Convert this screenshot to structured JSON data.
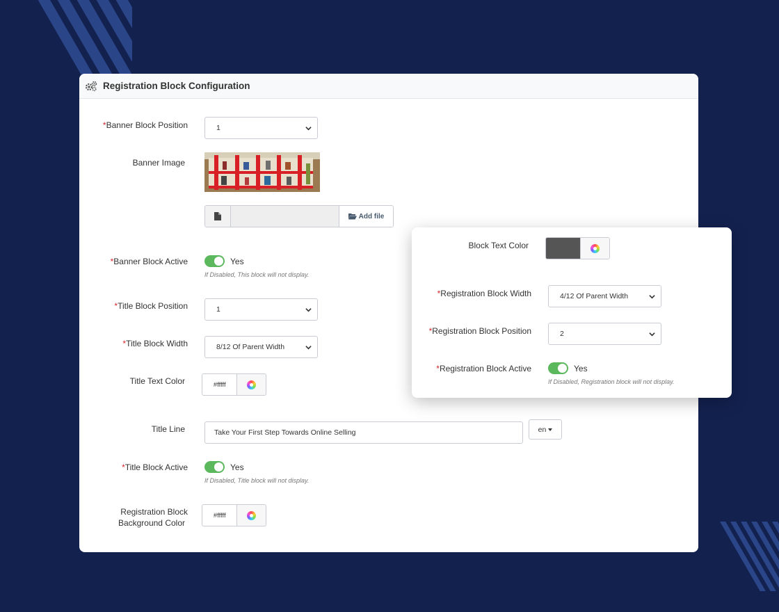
{
  "card": {
    "title": "Registration Block Configuration",
    "header_icon": "gears-icon"
  },
  "form": {
    "banner_block_position": {
      "label": "Banner Block Position",
      "required": "*",
      "value": "1"
    },
    "banner_image": {
      "label": "Banner Image",
      "image_icon": "shelf-display-image"
    },
    "file_upload": {
      "file_icon": "file-icon",
      "button_icon": "folder-open-icon",
      "button_label": "Add file"
    },
    "banner_block_active": {
      "label": "Banner Block Active",
      "required": "*",
      "toggle_text": "Yes",
      "help": "If Disabled, This block will not display.",
      "on": true
    },
    "title_block_position": {
      "label": "Title Block Position",
      "required": "*",
      "value": "1"
    },
    "title_block_width": {
      "label": "Title Block Width",
      "required": "*",
      "value": "8/12 Of Parent Width"
    },
    "title_text_color": {
      "label": "Title Text Color",
      "value": "#fffff",
      "picker_icon": "color-wheel-icon"
    },
    "title_line": {
      "label": "Title Line",
      "value": "Take Your First Step Towards Online Selling",
      "lang": "en"
    },
    "title_block_active": {
      "label": "Title Block Active",
      "required": "*",
      "toggle_text": "Yes",
      "help": "If Disabled, Title block will not display.",
      "on": true
    },
    "registration_block_bg_color": {
      "label_line1": "Registration Block",
      "label_line2": "Background Color",
      "value": "#fffff",
      "picker_icon": "color-wheel-icon"
    }
  },
  "panel": {
    "block_text_color": {
      "label": "Block Text Color",
      "swatch_color": "#555555",
      "picker_icon": "color-wheel-icon"
    },
    "registration_block_width": {
      "label": "Registration Block Width",
      "required": "*",
      "value": "4/12 Of Parent Width"
    },
    "registration_block_position": {
      "label": "Registration Block Position",
      "required": "*",
      "value": "2"
    },
    "registration_block_active": {
      "label": "Registration Block Active",
      "required": "*",
      "toggle_text": "Yes",
      "help": "If Disabled, Registration block will not display.",
      "on": true
    }
  },
  "colors": {
    "background": "#13214f",
    "toggle_on": "#5cb85c",
    "required": "#d9262c"
  }
}
